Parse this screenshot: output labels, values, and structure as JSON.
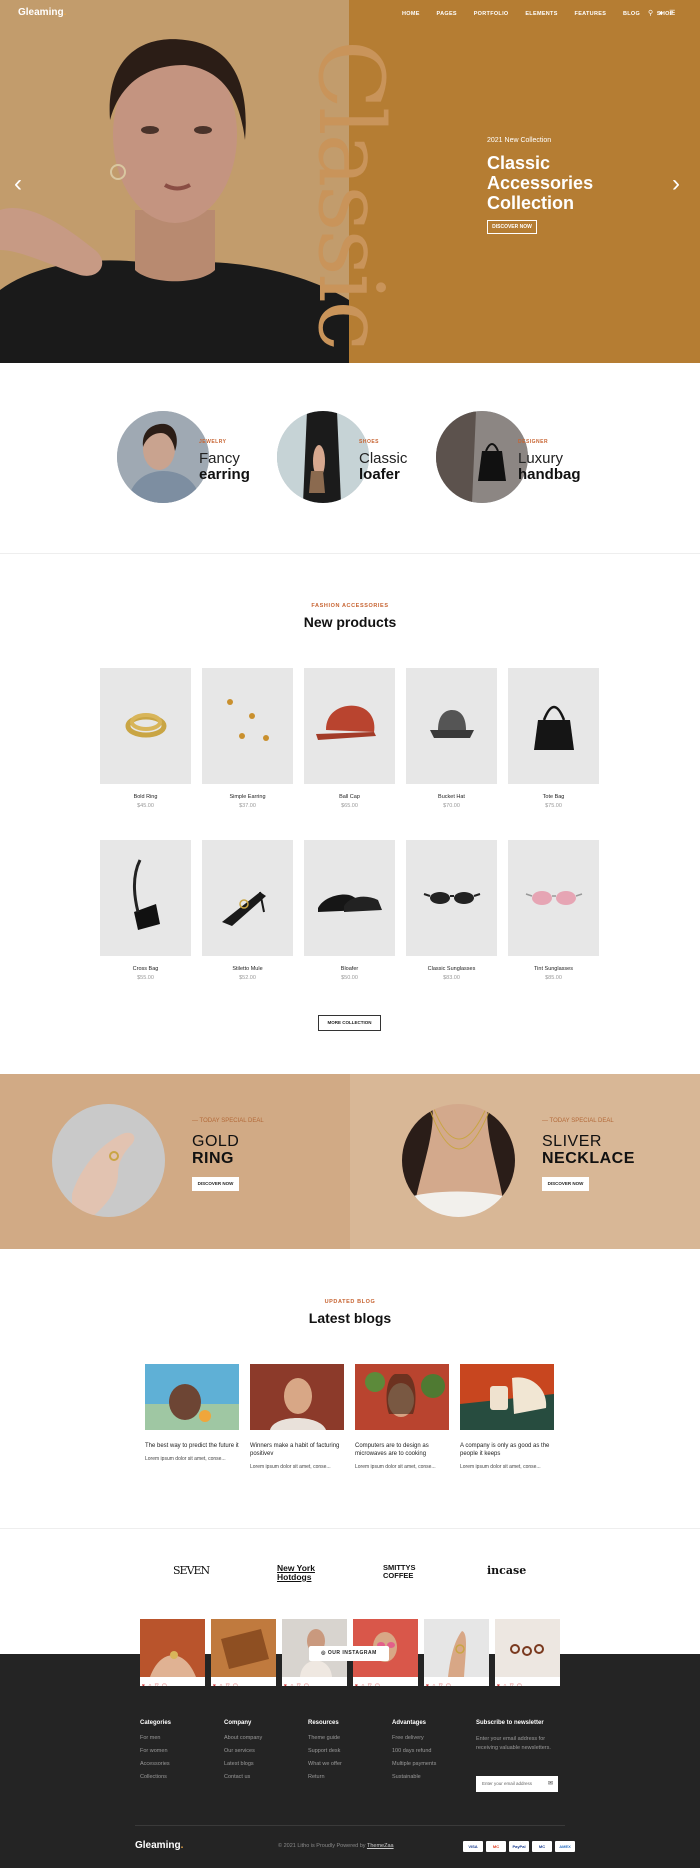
{
  "brand": {
    "logo": "Gleaming"
  },
  "nav": {
    "links": [
      "HOME",
      "PAGES",
      "PORTFOLIO",
      "ELEMENTS",
      "FEATURES",
      "BLOG",
      "SHOP"
    ]
  },
  "hero": {
    "vertical_word": "Classic",
    "tag": "2021 New Collection",
    "title": "Classic Accessories Collection",
    "button": "DISCOVER NOW",
    "prev_arrow": "‹",
    "next_arrow": "›"
  },
  "categories": [
    {
      "tag": "JEWELRY",
      "line1": "Fancy",
      "line2": "earring"
    },
    {
      "tag": "SHOES",
      "line1": "Classic",
      "line2": "loafer"
    },
    {
      "tag": "DESIGNER",
      "line1": "Luxury",
      "line2": "handbag"
    }
  ],
  "products_section": {
    "tag": "FASHION ACCESSORIES",
    "title": "New products",
    "more_button": "MORE COLLECTION"
  },
  "products": [
    {
      "name": "Bold Ring",
      "price": "$45.00"
    },
    {
      "name": "Simple Earring",
      "price": "$37.00"
    },
    {
      "name": "Ball Cap",
      "price": "$65.00"
    },
    {
      "name": "Bucket Hat",
      "price": "$70.00"
    },
    {
      "name": "Tote Bag",
      "price": "$75.00"
    },
    {
      "name": "Cross Bag",
      "price": "$55.00"
    },
    {
      "name": "Stiletto Mule",
      "price": "$52.00"
    },
    {
      "name": "Bloafer",
      "price": "$50.00"
    },
    {
      "name": "Classic Sunglasses",
      "price": "$83.00"
    },
    {
      "name": "Tint Sunglasses",
      "price": "$85.00"
    }
  ],
  "deals": [
    {
      "tag": "— TODAY SPECIAL DEAL",
      "line1": "GOLD",
      "line2": "RING",
      "button": "DISCOVER NOW"
    },
    {
      "tag": "— TODAY SPECIAL DEAL",
      "line1": "SLIVER",
      "line2": "NECKLACE",
      "button": "DISCOVER NOW"
    }
  ],
  "blog_section": {
    "tag": "UPDATED BLOG",
    "title": "Latest blogs"
  },
  "blogs": [
    {
      "title": "The best way to predict the future it",
      "excerpt": "Lorem ipsum dolor sit amet, conse..."
    },
    {
      "title": "Winners make a habit of facturing positivev",
      "excerpt": "Lorem ipsum dolor sit amet, conse..."
    },
    {
      "title": "Computers are to design as microwaves are to cooking",
      "excerpt": "Lorem ipsum dolor sit amet, conse..."
    },
    {
      "title": "A company is only as good as the people it keeps",
      "excerpt": "Lorem ipsum dolor sit amet, conse..."
    }
  ],
  "brands": [
    "SEVEN",
    "New York Hotdogs",
    "SMITTYS COFFEE",
    "incase"
  ],
  "instagram": {
    "button": "◎ OUR INSTAGRAM",
    "bar": "♥ ○ ▽ ▢"
  },
  "footer": {
    "columns": [
      {
        "head": "Categories",
        "links": [
          "For men",
          "For women",
          "Accessories",
          "Collections"
        ]
      },
      {
        "head": "Company",
        "links": [
          "About company",
          "Our services",
          "Latest blogs",
          "Contact us"
        ]
      },
      {
        "head": "Resources",
        "links": [
          "Theme guide",
          "Support desk",
          "What we offer",
          "Return"
        ]
      },
      {
        "head": "Advantages",
        "links": [
          "Free delivery",
          "100 days refund",
          "Multiple payments",
          "Sustainable"
        ]
      }
    ],
    "newsletter": {
      "head": "Subscribe to newsletter",
      "text": "Enter your email address for receiving valuable newsletters.",
      "placeholder": "Enter your email address"
    },
    "copyright": "© 2021 Litho is Proudly Powered by",
    "copyright_link": "ThemeZaa",
    "payments": [
      "VISA",
      "MC",
      "PayPal",
      "MC",
      "AMEX"
    ]
  },
  "colors": {
    "hero_left": "#c09a6b",
    "hero_right": "#b57d33",
    "accent": "#c76432",
    "footer": "#242424"
  }
}
